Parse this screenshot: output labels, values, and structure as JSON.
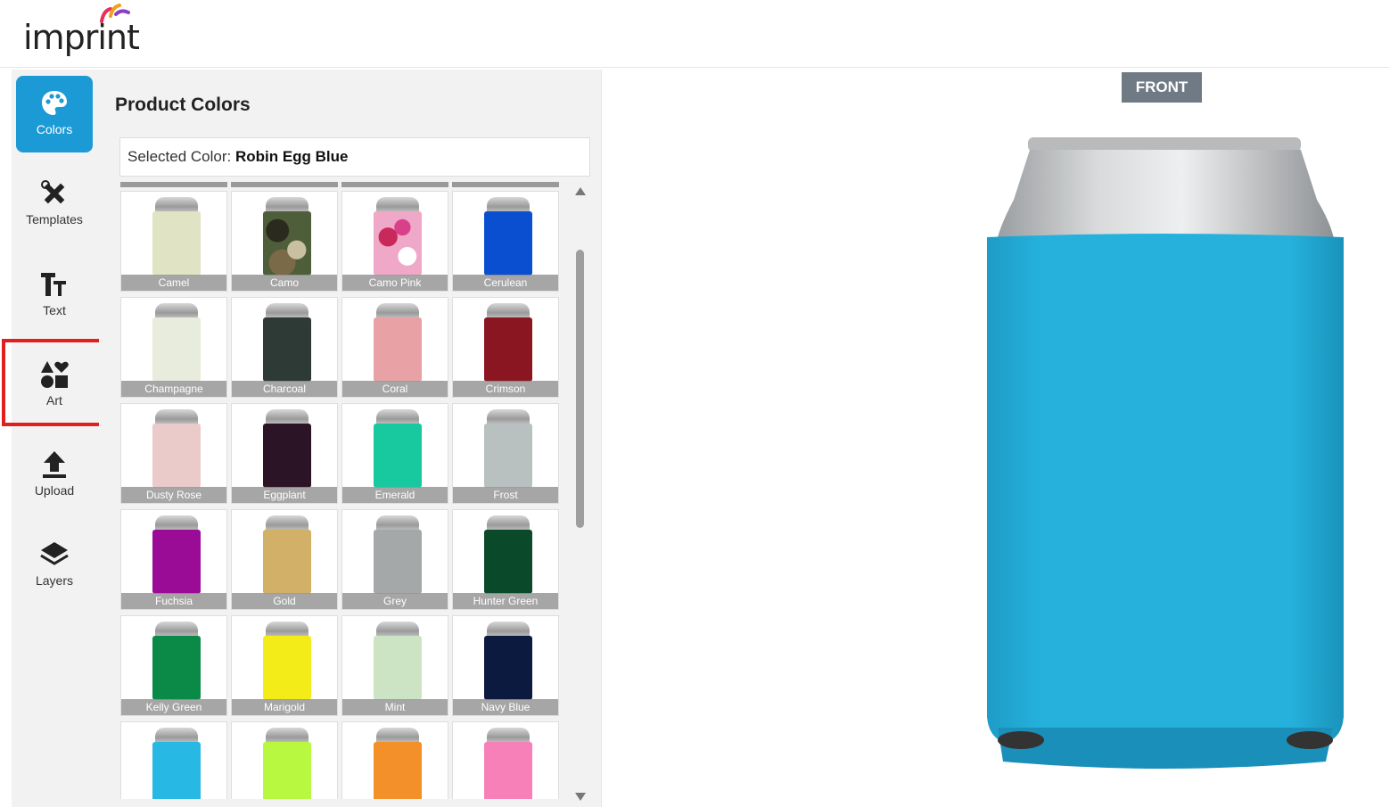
{
  "app": {
    "logo_text": "imprint"
  },
  "nav": {
    "items": [
      {
        "label": "Colors",
        "icon": "palette-icon",
        "active": true
      },
      {
        "label": "Templates",
        "icon": "tools-icon",
        "active": false
      },
      {
        "label": "Text",
        "icon": "text-size-icon",
        "active": false
      },
      {
        "label": "Art",
        "icon": "shapes-icon",
        "active": false,
        "highlighted": true
      },
      {
        "label": "Upload",
        "icon": "upload-icon",
        "active": false
      },
      {
        "label": "Layers",
        "icon": "layers-icon",
        "active": false
      }
    ]
  },
  "panel": {
    "title": "Product Colors",
    "selected_prefix": "Selected Color: ",
    "selected_value": "Robin Egg Blue"
  },
  "swatches": [
    {
      "name": "Camel",
      "color": "#e0e4c4"
    },
    {
      "name": "Camo",
      "color": "#4f5e3a"
    },
    {
      "name": "Camo Pink",
      "color": "#f0a8c8"
    },
    {
      "name": "Cerulean",
      "color": "#0a4fd0"
    },
    {
      "name": "Champagne",
      "color": "#e8ecdc"
    },
    {
      "name": "Charcoal",
      "color": "#2e3a36"
    },
    {
      "name": "Coral",
      "color": "#e8a2a6"
    },
    {
      "name": "Crimson",
      "color": "#8a1622"
    },
    {
      "name": "Dusty Rose",
      "color": "#ebcaca"
    },
    {
      "name": "Eggplant",
      "color": "#2a1426"
    },
    {
      "name": "Emerald",
      "color": "#18c89e"
    },
    {
      "name": "Frost",
      "color": "#b8c0c0"
    },
    {
      "name": "Fuchsia",
      "color": "#9a0c96"
    },
    {
      "name": "Gold",
      "color": "#d2b068"
    },
    {
      "name": "Grey",
      "color": "#a4a8a8"
    },
    {
      "name": "Hunter Green",
      "color": "#0a4a2a"
    },
    {
      "name": "Kelly Green",
      "color": "#0a8a46"
    },
    {
      "name": "Marigold",
      "color": "#f4ec18"
    },
    {
      "name": "Mint",
      "color": "#cce4c4"
    },
    {
      "name": "Navy Blue",
      "color": "#0c1a40"
    },
    {
      "name": "",
      "color": "#28b8e4"
    },
    {
      "name": "",
      "color": "#b8f840"
    },
    {
      "name": "",
      "color": "#f4902a"
    },
    {
      "name": "",
      "color": "#f880b8"
    }
  ],
  "canvas": {
    "view_label": "FRONT",
    "product_color": "#23afd9"
  }
}
